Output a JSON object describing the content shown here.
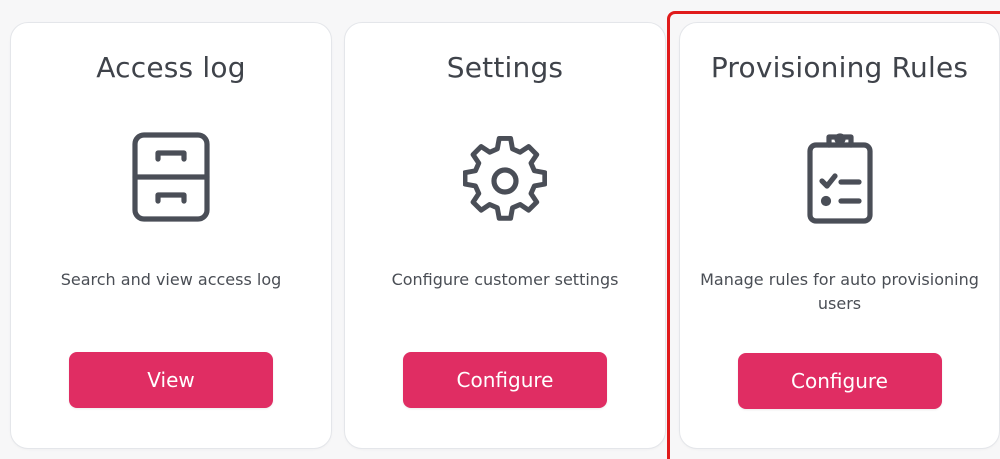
{
  "cards": [
    {
      "title": "Access log",
      "icon": "filing-cabinet-icon",
      "description": "Search and view access log",
      "button_label": "View"
    },
    {
      "title": "Settings",
      "icon": "gear-icon",
      "description": "Configure customer settings",
      "button_label": "Configure"
    },
    {
      "title": "Provisioning Rules",
      "icon": "clipboard-checklist-icon",
      "description": "Manage rules for auto provisioning users",
      "button_label": "Configure"
    }
  ],
  "colors": {
    "accent": "#e02d63",
    "icon": "#4a4e57",
    "highlight": "#e01b1b",
    "card_border": "#e4e6ea"
  }
}
